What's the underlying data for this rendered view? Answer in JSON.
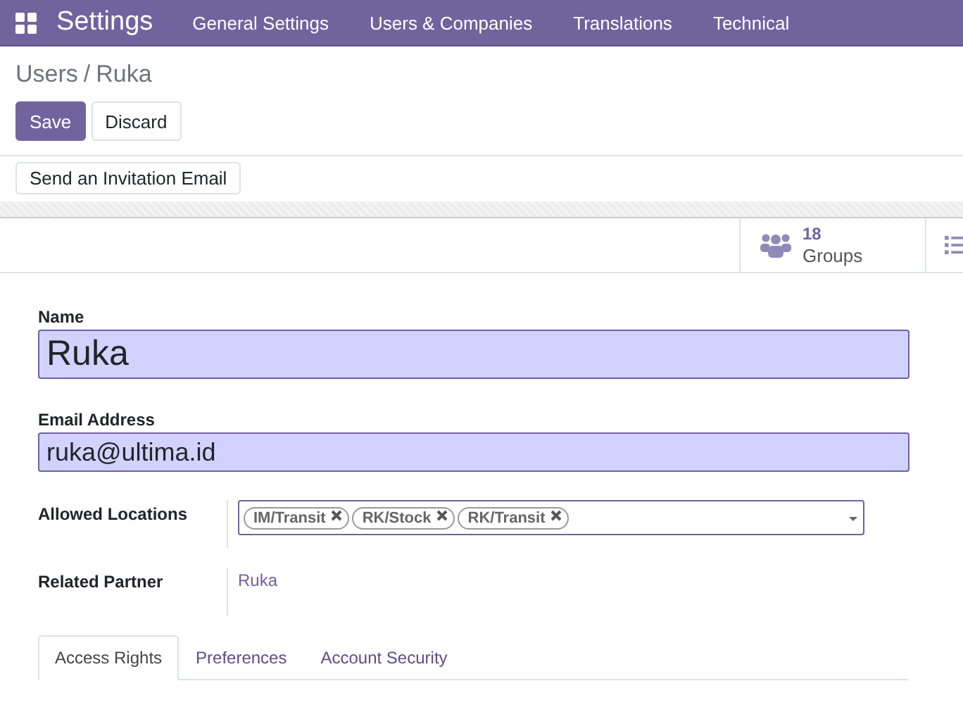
{
  "navbar": {
    "app_title": "Settings",
    "menu": [
      {
        "label": "General Settings"
      },
      {
        "label": "Users & Companies"
      },
      {
        "label": "Translations"
      },
      {
        "label": "Technical"
      }
    ]
  },
  "breadcrumb": {
    "parent": "Users",
    "separator": "/",
    "current": "Ruka"
  },
  "actions": [
    {
      "label": "Save",
      "kind": "primary"
    },
    {
      "label": "Discard",
      "kind": "secondary"
    }
  ],
  "header_buttons": [
    {
      "label": "Send an Invitation Email"
    }
  ],
  "smart_buttons": [
    {
      "kind": "groups",
      "count": "18",
      "label": "Groups"
    },
    {
      "kind": "list"
    }
  ],
  "form": {
    "name_label": "Name",
    "name_value": "Ruka",
    "email_label": "Email Address",
    "email_value": "ruka@ultima.id",
    "fields": [
      {
        "kind": "tags",
        "label": "Allowed Locations",
        "tags": [
          "IM/Transit",
          "RK/Stock",
          "RK/Transit"
        ]
      },
      {
        "kind": "link",
        "label": "Related Partner",
        "value": "Ruka"
      }
    ]
  },
  "tabs": [
    {
      "label": "Access Rights",
      "selected": true
    },
    {
      "label": "Preferences",
      "selected": false
    },
    {
      "label": "Account Security",
      "selected": false
    }
  ]
}
